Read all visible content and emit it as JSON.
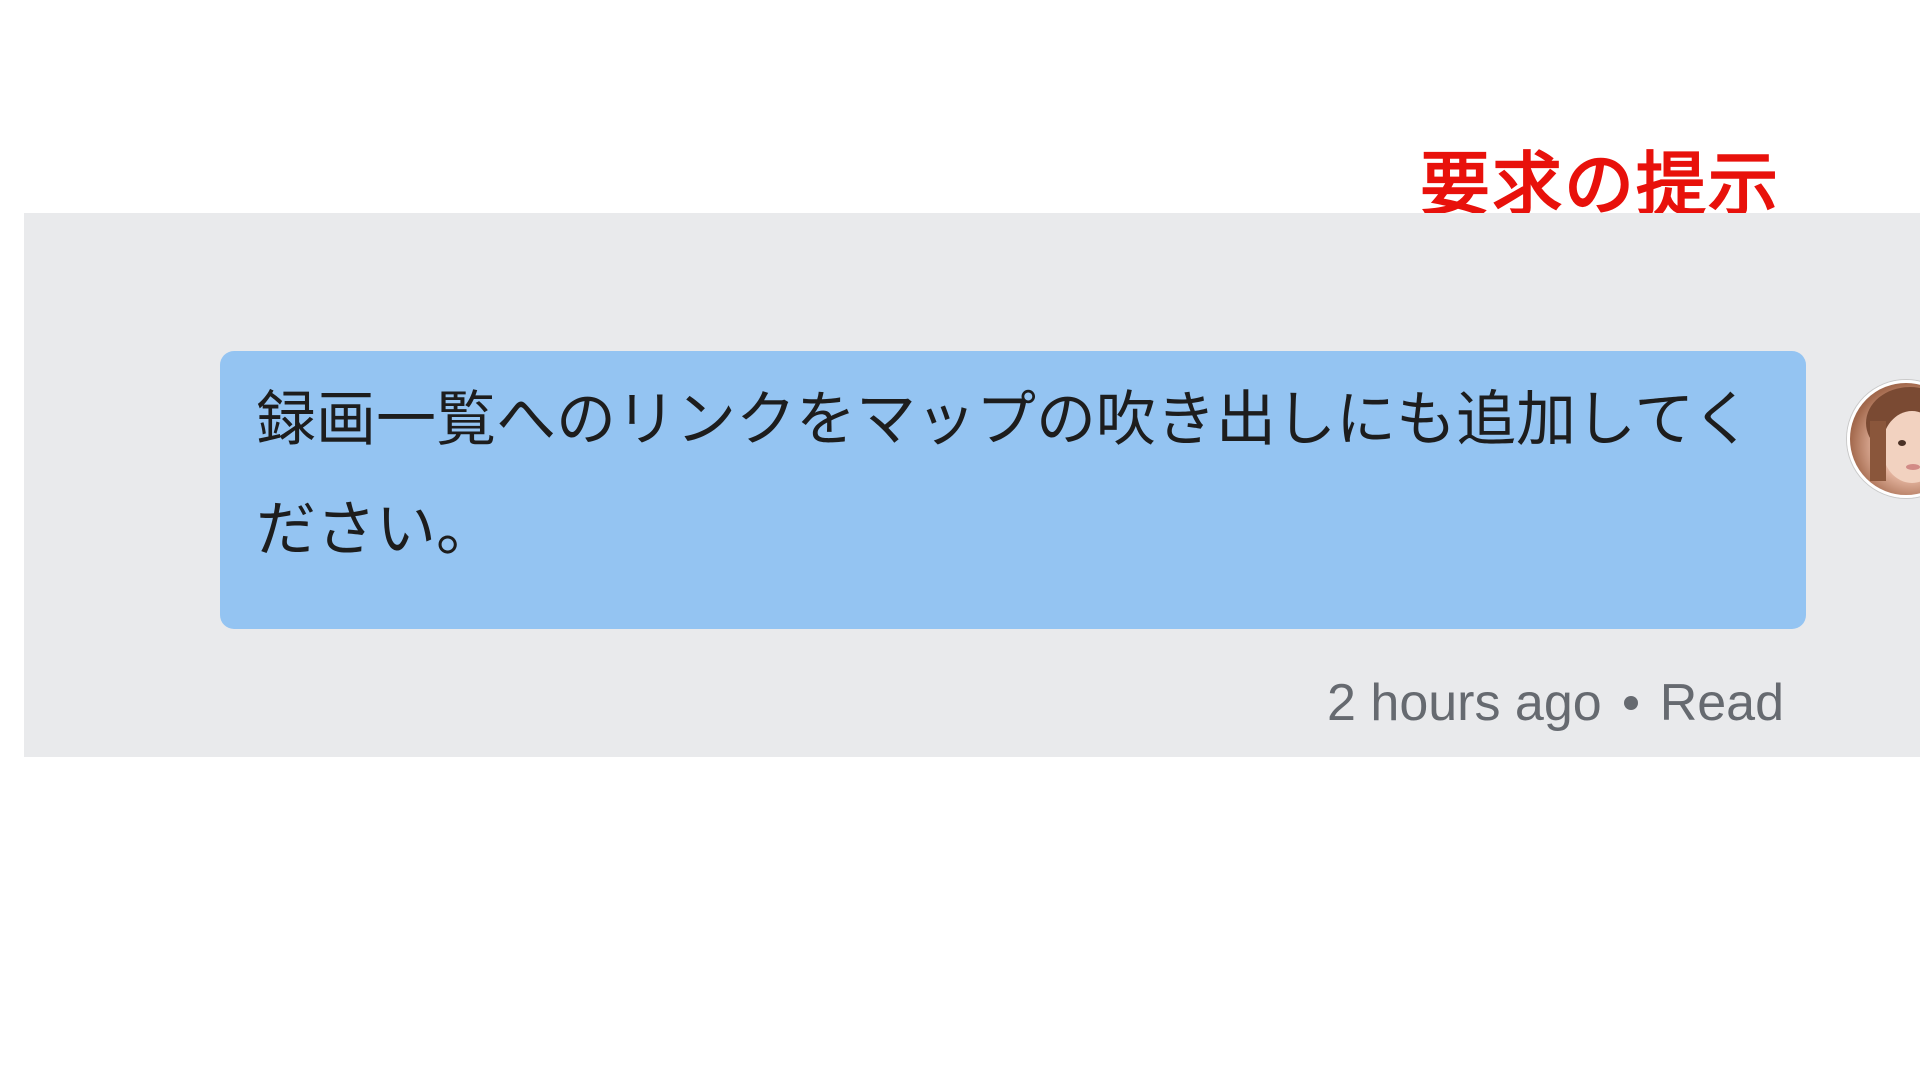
{
  "annotation": {
    "text": "要求の提示",
    "color": "#e8110b"
  },
  "message": {
    "text": "録画一覧へのリンクをマップの吹き出しにも追加してください。",
    "bubble_color": "#94c4f2",
    "timestamp": "2 hours ago",
    "separator_icon": "bullet-dot-icon",
    "status": "Read"
  },
  "avatar": {
    "icon": "user-avatar-photo"
  },
  "colors": {
    "panel_background": "#e9eaec",
    "meta_text": "#666a70"
  }
}
